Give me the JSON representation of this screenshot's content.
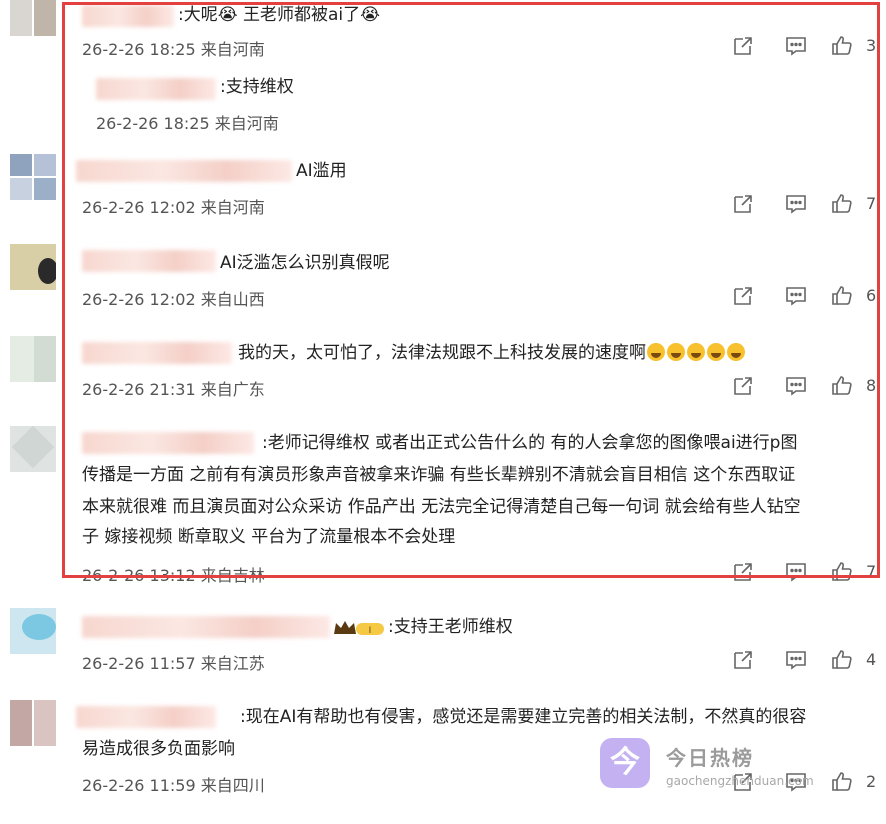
{
  "comments": [
    {
      "text": ":大呢😭 王老师都被ai了😭",
      "date": "26-2-26 18:25",
      "location": "来自河南",
      "likes": "3"
    },
    {
      "text": ":支持维权",
      "date": "26-2-26 18:25",
      "location": "来自河南"
    },
    {
      "text": "AI滥用",
      "date": "26-2-26 12:02",
      "location": "来自河南",
      "likes": "7"
    },
    {
      "text": "AI泛滥怎么识别真假呢",
      "date": "26-2-26 12:02",
      "location": "来自山西",
      "likes": "6"
    },
    {
      "text": "我的天，太可怕了，法律法规跟不上科技发展的速度啊",
      "date": "26-2-26 21:31",
      "location": "来自广东",
      "likes": "8"
    },
    {
      "lines": [
        ":老师记得维权 或者出正式公告什么的 有的人会拿您的图像喂ai进行p图",
        "传播是一方面 之前有有演员形象声音被拿来诈骗 有些长辈辨别不清就会盲目相信 这个东西取证",
        "本来就很难 而且演员面对公众采访 作品产出 无法完全记得清楚自己每一句词 就会给有些人钻空",
        "子 嫁接视频 断章取义 平台为了流量根本不会处理"
      ],
      "date": "26-2-26 13:12",
      "location": "来自吉林",
      "likes": "7"
    },
    {
      "text": ":支持王老师维权",
      "date": "26-2-26 11:57",
      "location": "来自江苏",
      "likes": "4"
    },
    {
      "lines": [
        ":现在AI有帮助也有侵害，感觉还是需要建立完善的相关法制，不然真的很容",
        "易造成很多负面影响"
      ],
      "date": "26-2-26 11:59",
      "location": "来自四川",
      "likes": "2"
    }
  ],
  "watermark": {
    "title": "今日热榜",
    "url": "gaochengzhenduan.com",
    "logo_glyph": "今"
  },
  "colors": {
    "highlight_border": "#e3413f",
    "text": "#222222",
    "meta": "#555555"
  },
  "icons": [
    "share-icon",
    "comment-icon",
    "like-icon"
  ]
}
